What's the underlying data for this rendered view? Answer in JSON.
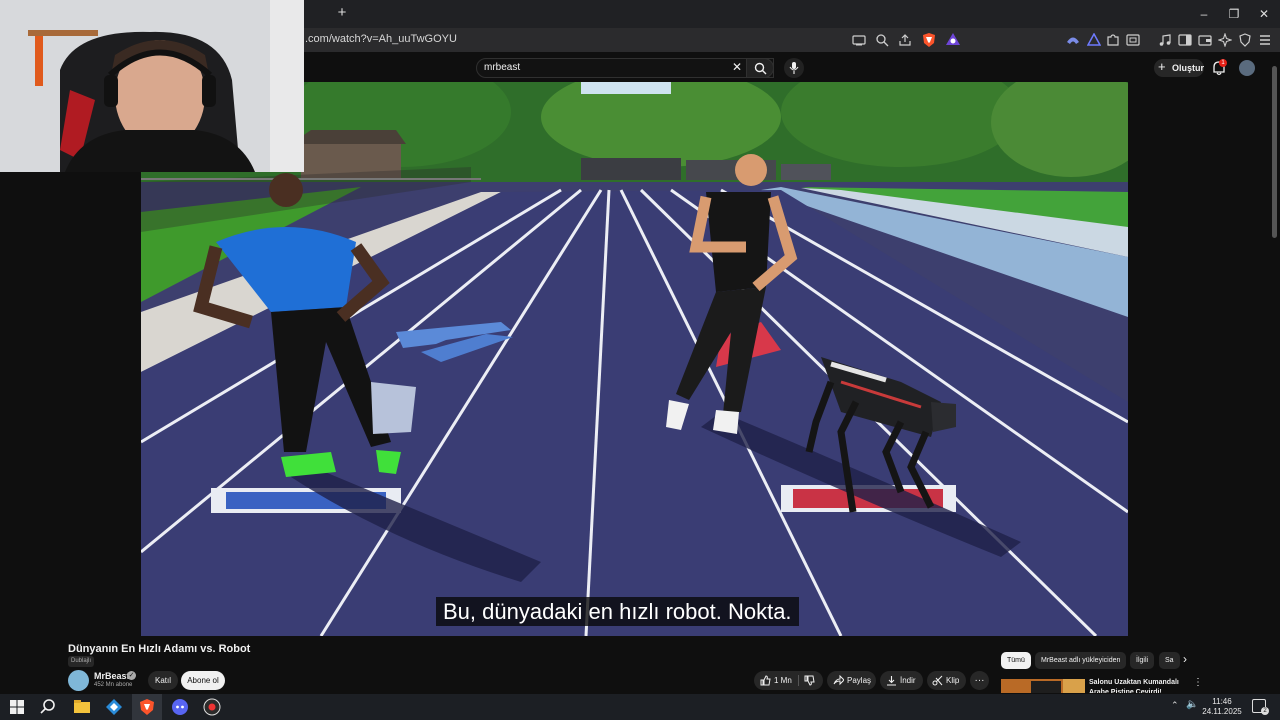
{
  "browser": {
    "new_tab": "+",
    "url": ".com/watch?v=Ah_uuTwGOYU",
    "window_controls": {
      "minimize": "–",
      "restore": "❐",
      "close": "✕"
    }
  },
  "youtube_header": {
    "search_value": "mrbeast",
    "create_label": "Oluştur",
    "notification_count": "1"
  },
  "video": {
    "caption": "Bu, dünyadaki en hızlı robot. Nokta."
  },
  "video_info": {
    "title": "Dünyanın En Hızlı Adamı vs. Robot",
    "dubbed_label": "Dublajlı",
    "channel_name": "MrBeast",
    "subscribers": "452 Mn abone",
    "join_label": "Katıl",
    "subscribe_label": "Abone ol",
    "like_count": "1 Mn",
    "share_label": "Paylaş",
    "download_label": "İndir",
    "clip_label": "Klip",
    "more_label": "···"
  },
  "recommendations": {
    "chips": [
      "Tümü",
      "MrBeast adlı yükleyiciden",
      "İlgili",
      "Sa"
    ],
    "first_title": "Salonu Uzaktan Kumandalı Arabe Pistine Çevirdi!"
  },
  "taskbar": {
    "time": "11:46",
    "date": "24.11.2025",
    "notification_count": "2"
  }
}
